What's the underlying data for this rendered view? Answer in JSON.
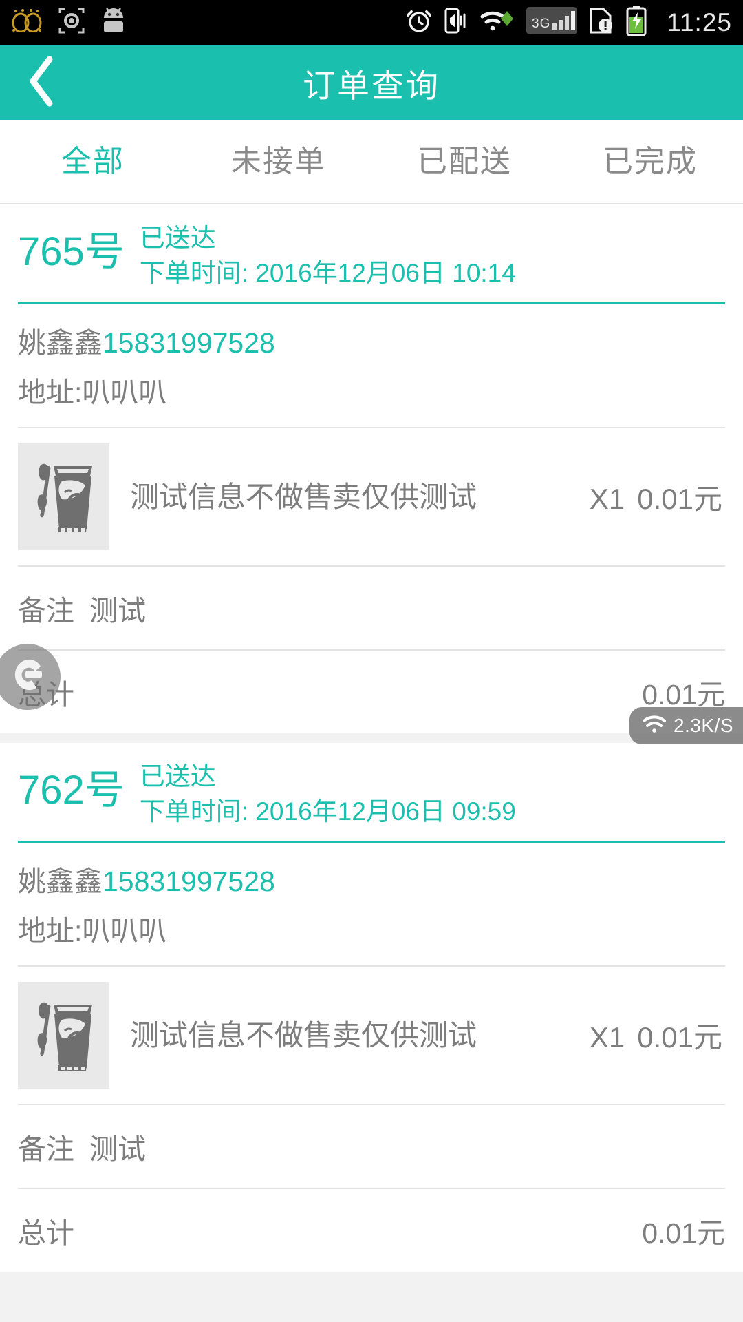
{
  "statusbar": {
    "time": "11:25",
    "left_icons": [
      "glasses-icon",
      "camera-icon",
      "android-robot-icon"
    ],
    "right_icons": [
      "alarm-clock-icon",
      "vibrate-icon",
      "wifi-sync-icon",
      "3g-signal-icon",
      "sim-card-alert-icon",
      "battery-charging-icon"
    ],
    "signal_label": "3G"
  },
  "header": {
    "title": "订单查询",
    "back_icon": "chevron-left-icon",
    "bg_color": "#1bbfad"
  },
  "tabs": [
    {
      "label": "全部",
      "active": true
    },
    {
      "label": "未接单",
      "active": false
    },
    {
      "label": "已配送",
      "active": false
    },
    {
      "label": "已完成",
      "active": false
    }
  ],
  "orders": [
    {
      "number": "765号",
      "status": "已送达",
      "time_label": "下单时间: 2016年12月06日 10:14",
      "customer_name": "姚鑫鑫",
      "customer_phone": "15831997528",
      "address": "地址:叭叭叭",
      "items": [
        {
          "name": "测试信息不做售卖仅供测试",
          "qty": "X1",
          "price": "0.01元",
          "thumb": "product-thumbnail-cup"
        }
      ],
      "note_label": "备注",
      "note_value": "测试",
      "total_label": "总计",
      "total_value": "0.01元"
    },
    {
      "number": "762号",
      "status": "已送达",
      "time_label": "下单时间: 2016年12月06日 09:59",
      "customer_name": "姚鑫鑫",
      "customer_phone": "15831997528",
      "address": "地址:叭叭叭",
      "items": [
        {
          "name": "测试信息不做售卖仅供测试",
          "qty": "X1",
          "price": "0.01元",
          "thumb": "product-thumbnail-cup"
        }
      ],
      "note_label": "备注",
      "note_value": "测试",
      "total_label": "总计",
      "total_value": "0.01元"
    }
  ],
  "floating": {
    "assistant_ball_icon": "e-logo-icon",
    "speed_badge": {
      "icon": "wifi-icon",
      "text": "2.3K/S"
    }
  },
  "colors": {
    "accent": "#1bbfad",
    "text_grey": "#7d7d7d",
    "tab_inactive": "#8a8a8a",
    "page_bg": "#f2f2f2"
  }
}
